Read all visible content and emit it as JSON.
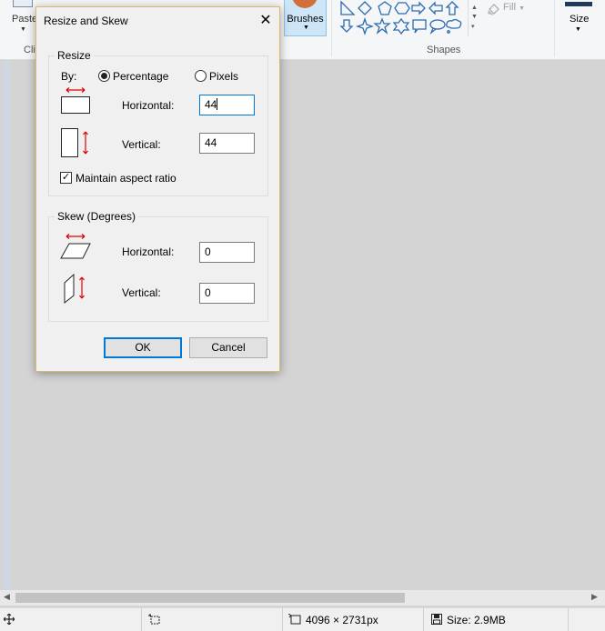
{
  "ribbon": {
    "paste_label": "Paste",
    "clipboard_group_label": "Cli",
    "brushes_label": "Brushes",
    "fill_label": "Fill",
    "size_label": "Size",
    "shapes_group_label": "Shapes",
    "shape_icons": [
      "right-triangle-icon",
      "diamond-icon",
      "pentagon-icon",
      "hexagon-icon",
      "right-arrow-icon",
      "left-arrow-icon",
      "up-arrow-icon",
      "down-arrow-icon",
      "four-point-star-icon",
      "five-point-star-icon",
      "six-point-star-icon",
      "rounded-callout-icon",
      "oval-callout-icon",
      "cloud-callout-icon"
    ],
    "accent_color": "#2b6cb3"
  },
  "dialog": {
    "title": "Resize and Skew",
    "resize": {
      "group_label": "Resize",
      "by_label": "By:",
      "percentage_label": "Percentage",
      "pixels_label": "Pixels",
      "percentage_selected": true,
      "horizontal_label": "Horizontal:",
      "horizontal_value": "44",
      "vertical_label": "Vertical:",
      "vertical_value": "44",
      "maintain_aspect_label": "Maintain aspect ratio",
      "maintain_aspect_checked": true
    },
    "skew": {
      "group_label": "Skew (Degrees)",
      "horizontal_label": "Horizontal:",
      "horizontal_value": "0",
      "vertical_label": "Vertical:",
      "vertical_value": "0"
    },
    "ok_label": "OK",
    "cancel_label": "Cancel"
  },
  "statusbar": {
    "dimensions": "4096 × 2731px",
    "size": "Size: 2.9MB"
  }
}
